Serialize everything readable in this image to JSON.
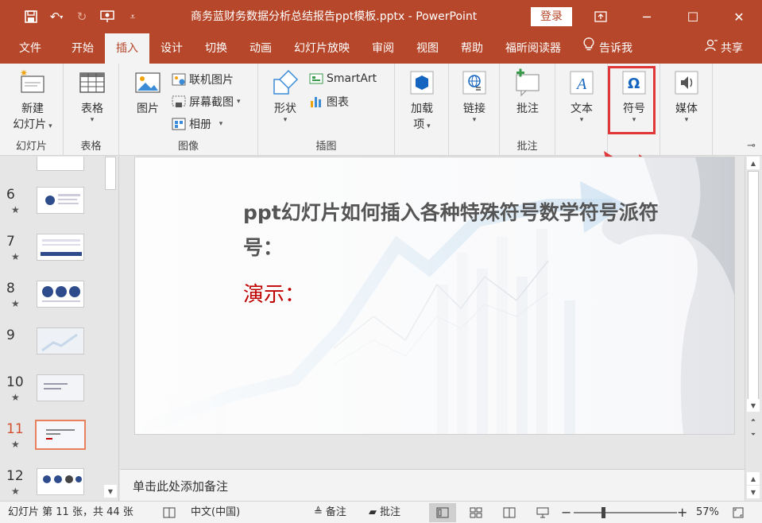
{
  "window": {
    "title": "商务蓝财务数据分析总结报告ppt模板.pptx  -  PowerPoint",
    "login_label": "登录"
  },
  "tabs": [
    "文件",
    "开始",
    "插入",
    "设计",
    "切换",
    "动画",
    "幻灯片放映",
    "审阅",
    "视图",
    "帮助",
    "福昕阅读器"
  ],
  "active_tab": "插入",
  "tell_me": "告诉我",
  "share": "共享",
  "ribbon": {
    "new_slide": {
      "line1": "新建",
      "line2": "幻灯片"
    },
    "group_slides": "幻灯片",
    "table": "表格",
    "group_table": "表格",
    "picture": "图片",
    "online_picture": "联机图片",
    "screenshot": "屏幕截图",
    "album": "相册",
    "group_images": "图像",
    "shapes": "形状",
    "smartart": "SmartArt",
    "chart": "图表",
    "group_illustrations": "插图",
    "addins": {
      "line1": "加载",
      "line2": "项"
    },
    "link": "链接",
    "comment": "批注",
    "group_comments": "批注",
    "text": "文本",
    "symbols": "符号",
    "media": "媒体"
  },
  "thumbnails": [
    {
      "num": "6"
    },
    {
      "num": "7"
    },
    {
      "num": "8"
    },
    {
      "num": "9"
    },
    {
      "num": "10"
    },
    {
      "num": "11",
      "active": true
    },
    {
      "num": "12"
    }
  ],
  "slide": {
    "title": "ppt幻灯片如何插入各种特殊符号数学符号派符号：",
    "demo": "演示："
  },
  "notes_placeholder": "单击此处添加备注",
  "status": {
    "slide_info": "幻灯片 第 11 张，共 44 张",
    "language": "中文(中国)",
    "notes": "备注",
    "comments": "批注",
    "zoom": "57%"
  },
  "colors": {
    "accent": "#b7472a",
    "highlight": "#e0373a",
    "demo_text": "#c00000"
  }
}
